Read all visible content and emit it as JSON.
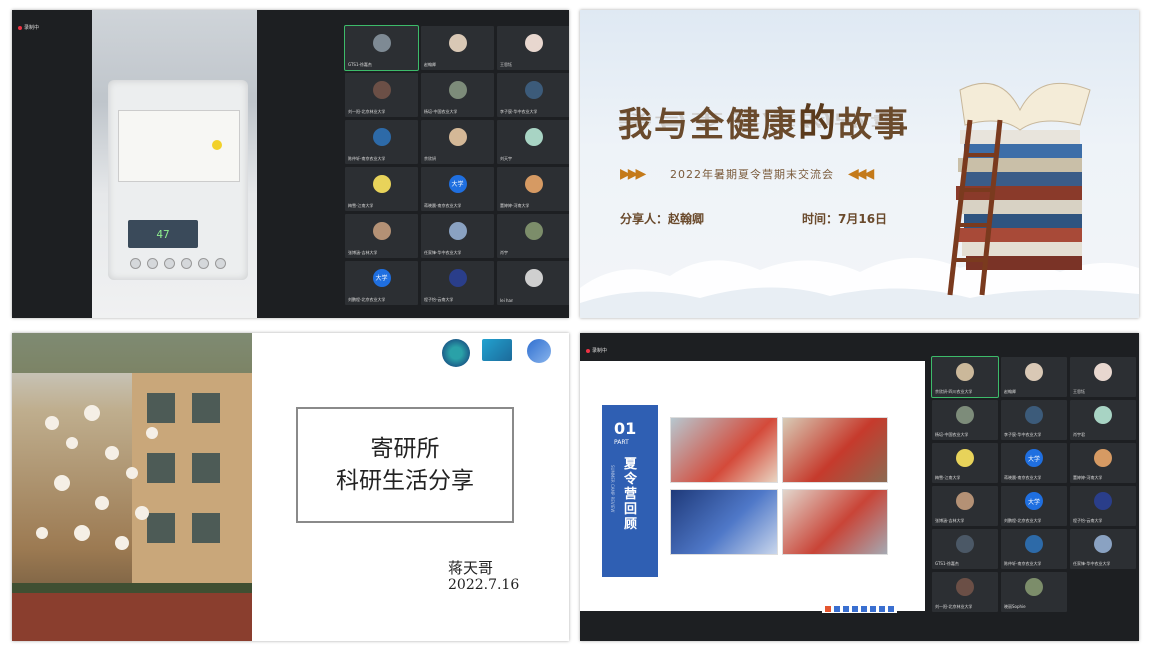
{
  "q1": {
    "recording_label": "录制中",
    "display_value": "47",
    "participants": [
      {
        "name": "GTS1-徐嘉杰",
        "avatar": "",
        "color": "#7e8a94",
        "active": true
      },
      {
        "name": "赵翰卿",
        "avatar": "",
        "color": "#d9c8b5"
      },
      {
        "name": "王思钰",
        "avatar": "",
        "color": "#e8d7cf"
      },
      {
        "name": "刘一阳-北京林业大学",
        "avatar": "",
        "color": "#6b4f46"
      },
      {
        "name": "杨培-中国农业大学",
        "avatar": "",
        "color": "#7d8c7a"
      },
      {
        "name": "李子宸-华中农业大学",
        "avatar": "",
        "color": "#3c5b7a"
      },
      {
        "name": "陈仲轩-南京农业大学",
        "avatar": "",
        "color": "#2d6aa8"
      },
      {
        "name": "余欣妍",
        "avatar": "",
        "color": "#d4b897"
      },
      {
        "name": "刘天宇",
        "avatar": "",
        "color": "#a8d4c4"
      },
      {
        "name": "梅雪-江南大学",
        "avatar": "",
        "color": "#e8d35a"
      },
      {
        "name": "蒋晓晨-南京农业大学",
        "avatar": "大学",
        "color": "#1f6fe0"
      },
      {
        "name": "董婷婷-河南大学",
        "avatar": "",
        "color": "#d69a63"
      },
      {
        "name": "张博涵-吉林大学",
        "avatar": "",
        "color": "#b49175"
      },
      {
        "name": "任家锋-华中农业大学",
        "avatar": "",
        "color": "#8aa2c2"
      },
      {
        "name": "肖宇",
        "avatar": "",
        "color": "#7c8d6a"
      },
      {
        "name": "刘鹏程-北京农业大学",
        "avatar": "大学",
        "color": "#1f6fe0"
      },
      {
        "name": "程子怡-云南大学",
        "avatar": "",
        "color": "#2a3e8a"
      },
      {
        "name": "lei han",
        "avatar": "",
        "color": "#cfcfcf"
      }
    ]
  },
  "q2": {
    "title_part1": "我与全健康",
    "title_big": "的",
    "title_part2": "故事",
    "subtitle": "2022年暑期夏令营期末交流会",
    "sharer": "分享人：赵翰卿",
    "time": "时间：7月16日"
  },
  "q3": {
    "title_line1": "寄研所",
    "title_line2": "科研生活分享",
    "author": "蒋天哥",
    "date": "2022.7.16"
  },
  "q4": {
    "recording_label": "录制中",
    "section_number": "01",
    "section_part": "PART",
    "section_title": "夏令营回顾",
    "section_en": "SUMMER CAMP REVIEW",
    "participants": [
      {
        "name": "余欣妍-四川农业大学",
        "color": "#cbb89a",
        "active": true
      },
      {
        "name": "赵翰卿",
        "color": "#d9c8b5"
      },
      {
        "name": "王思钰",
        "color": "#e8d7cf"
      },
      {
        "name": "杨培-中国农业大学",
        "color": "#7d8c7a"
      },
      {
        "name": "李子宸-华中农业大学",
        "color": "#3c5b7a"
      },
      {
        "name": "肖宇君",
        "color": "#a8d4c4"
      },
      {
        "name": "梅雪-江南大学",
        "color": "#e8d35a"
      },
      {
        "name": "蒋晓晨-南京农业大学",
        "color": "#1f6fe0",
        "avatar": "大学"
      },
      {
        "name": "董婷婷-河南大学",
        "color": "#d69a63"
      },
      {
        "name": "张博涵-吉林大学",
        "color": "#b49175"
      },
      {
        "name": "刘鹏程-北京农业大学",
        "color": "#1f6fe0",
        "avatar": "大学"
      },
      {
        "name": "程子怡-云南大学",
        "color": "#2a3e8a"
      },
      {
        "name": "GTS1-徐嘉杰",
        "color": "#4b5866"
      },
      {
        "name": "陈仲轩-南京农业大学",
        "color": "#2d6aa8"
      },
      {
        "name": "任家锋-华中农业大学",
        "color": "#8aa2c2"
      },
      {
        "name": "刘一阳-北京林业大学",
        "color": "#6b4f46"
      },
      {
        "name": "晓丽Sophie",
        "color": "#7c8d6a"
      }
    ]
  }
}
